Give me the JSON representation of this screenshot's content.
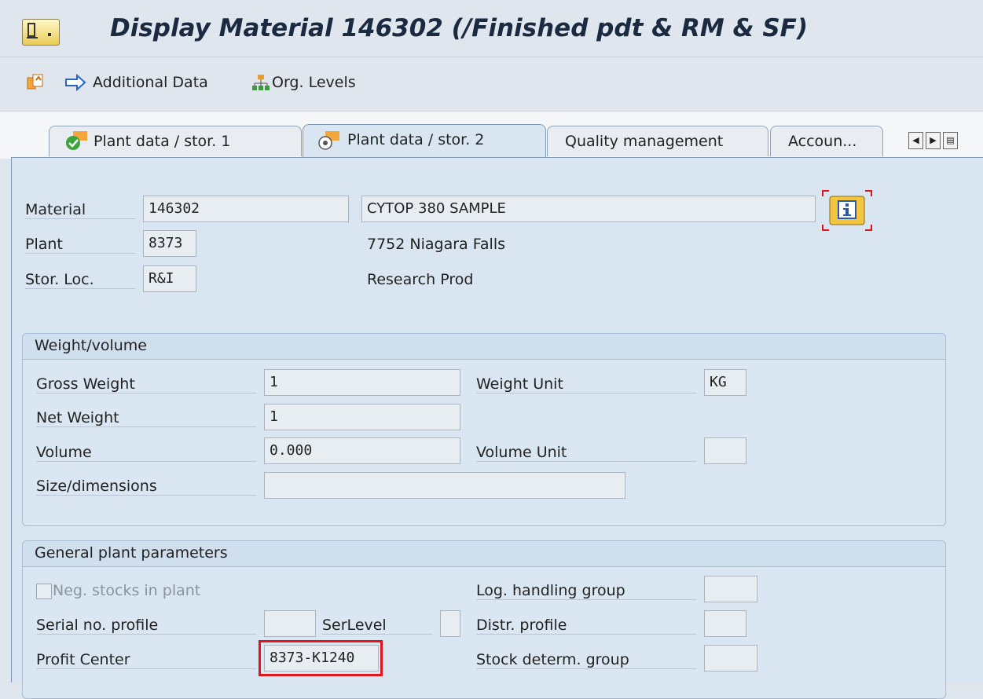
{
  "title": "Display Material 146302 (/Finished pdt & RM & SF)",
  "toolbar": {
    "additional_data": "Additional Data",
    "org_levels": "Org. Levels"
  },
  "tabs": [
    {
      "label": "Plant data / stor. 1"
    },
    {
      "label": "Plant data / stor. 2"
    },
    {
      "label": "Quality management"
    },
    {
      "label": "Accoun..."
    }
  ],
  "header": {
    "material_label": "Material",
    "material_value": "146302",
    "material_desc": "CYTOP 380 SAMPLE",
    "plant_label": "Plant",
    "plant_value": "8373",
    "plant_desc": "7752 Niagara Falls",
    "storloc_label": "Stor. Loc.",
    "storloc_value": "R&I",
    "storloc_desc": "Research Prod"
  },
  "weight_volume": {
    "title": "Weight/volume",
    "gross_weight_label": "Gross Weight",
    "gross_weight_value": "1",
    "weight_unit_label": "Weight Unit",
    "weight_unit_value": "KG",
    "net_weight_label": "Net Weight",
    "net_weight_value": "1",
    "volume_label": "Volume",
    "volume_value": "0.000",
    "volume_unit_label": "Volume Unit",
    "volume_unit_value": "",
    "size_label": "Size/dimensions",
    "size_value": ""
  },
  "general": {
    "title": "General plant parameters",
    "neg_stocks_label": "Neg. stocks in plant",
    "log_handling_label": "Log. handling group",
    "serial_profile_label": "Serial no. profile",
    "serlevel_label": "SerLevel",
    "distr_profile_label": "Distr. profile",
    "profit_center_label": "Profit Center",
    "profit_center_value": "8373-K1240",
    "stock_determ_label": "Stock determ. group"
  },
  "colors": {
    "highlight": "#e0141a",
    "background": "#d9e6f2"
  }
}
